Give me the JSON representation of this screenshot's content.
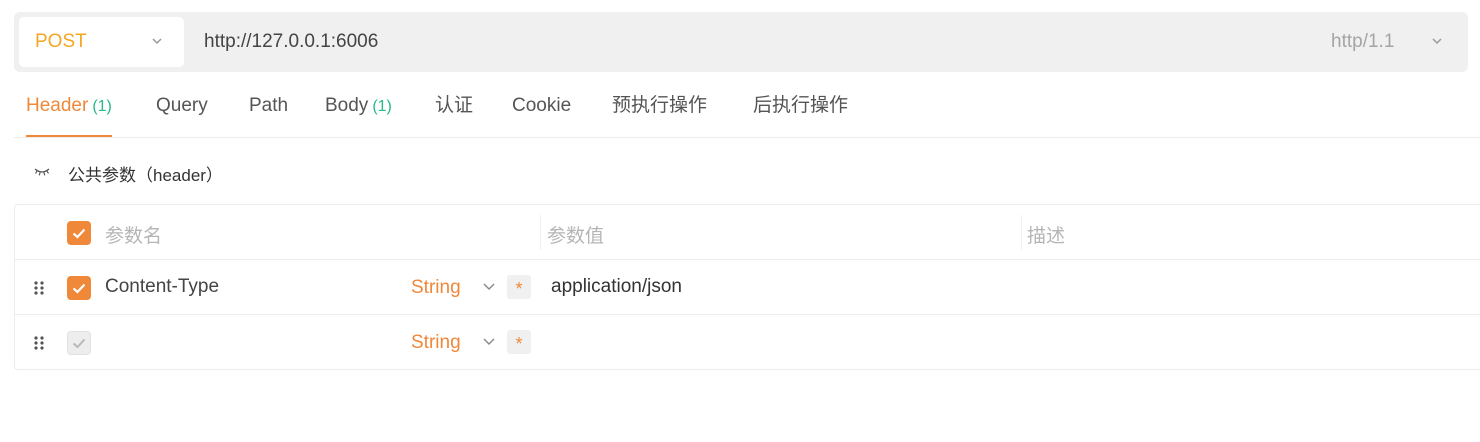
{
  "request": {
    "method": "POST",
    "url": "http://127.0.0.1:6006",
    "protocol": "http/1.1"
  },
  "tabs": [
    {
      "label": "Header",
      "count": "(1)",
      "active": true
    },
    {
      "label": "Query",
      "count": ""
    },
    {
      "label": "Path",
      "count": ""
    },
    {
      "label": "Body",
      "count": "(1)"
    },
    {
      "label": "认证",
      "count": ""
    },
    {
      "label": "Cookie",
      "count": ""
    },
    {
      "label": "预执行操作",
      "count": ""
    },
    {
      "label": "后执行操作",
      "count": ""
    }
  ],
  "section": {
    "title": "公共参数（header）",
    "icon": "eye-closed-icon"
  },
  "table": {
    "headers": {
      "name": "参数名",
      "value": "参数值",
      "desc": "描述"
    },
    "rows": [
      {
        "checked": true,
        "name": "Content-Type",
        "type": "String",
        "required_mark": "*",
        "value": "application/json"
      },
      {
        "checked": false,
        "name": "",
        "type": "String",
        "required_mark": "*",
        "value": ""
      }
    ]
  },
  "colors": {
    "accent": "#f0883a",
    "method": "#f5a623",
    "count": "#26b98a"
  }
}
